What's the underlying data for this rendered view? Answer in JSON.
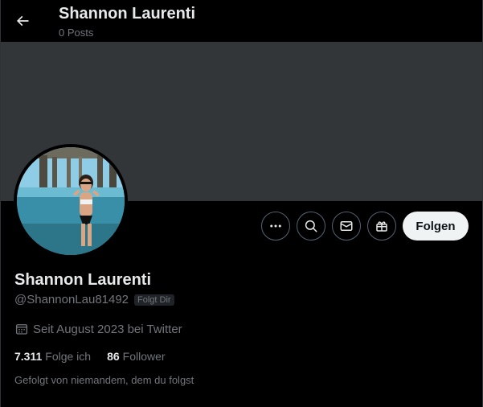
{
  "header": {
    "name": "Shannon Laurenti",
    "posts": "0 Posts"
  },
  "profile": {
    "name": "Shannon Laurenti",
    "handle": "@ShannonLau81492",
    "follows_you_badge": "Folgt Dir",
    "joined": "Seit August 2023 bei Twitter",
    "following_count": "7.311",
    "following_label": "Folge ich",
    "followers_count": "86",
    "followers_label": "Follower",
    "followed_by": "Gefolgt von niemandem, dem du folgst"
  },
  "actions": {
    "more_icon": "more-icon",
    "search_icon": "search-icon",
    "message_icon": "envelope-icon",
    "subscribe_icon": "gift-icon",
    "follow_label": "Folgen"
  },
  "colors": {
    "background": "#000000",
    "banner": "#333639",
    "text_primary": "#e7e9ea",
    "text_secondary": "#71767b",
    "follow_button_bg": "#eff3f4"
  }
}
